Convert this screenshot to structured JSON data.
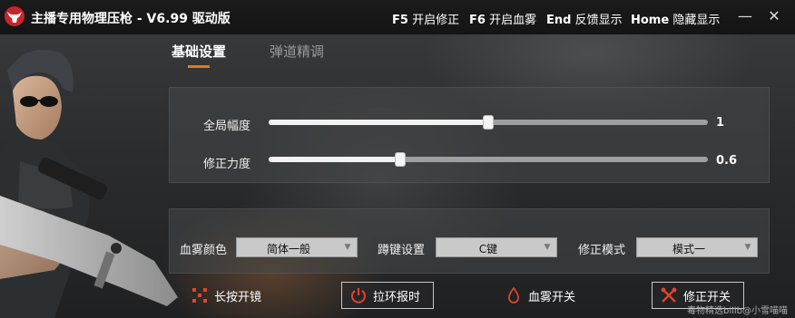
{
  "window": {
    "title": "主播专用物理压枪  - V6.99 驱动版",
    "hotkeys": [
      {
        "key": "F5",
        "label": "开启修正"
      },
      {
        "key": "F6",
        "label": "开启血雾"
      },
      {
        "key": "End",
        "label": "反馈显示"
      },
      {
        "key": "Home",
        "label": "隐藏显示"
      }
    ],
    "minimize": "—",
    "close": "✕"
  },
  "tabs": [
    {
      "label": "基础设置",
      "active": true
    },
    {
      "label": "弹道精调",
      "active": false
    }
  ],
  "sliders": [
    {
      "label": "全局幅度",
      "value": "1",
      "fraction": 0.5
    },
    {
      "label": "修正力度",
      "value": "0.6",
      "fraction": 0.3
    }
  ],
  "selects": [
    {
      "label": "血雾颜色",
      "value": "简体一般"
    },
    {
      "label": "蹲键设置",
      "value": "C键"
    },
    {
      "label": "修正模式",
      "value": "模式一"
    }
  ],
  "buttons": [
    {
      "label": "长按开镜",
      "icon": "crosshair-icon"
    },
    {
      "label": "拉环报时",
      "icon": "power-icon"
    },
    {
      "label": "血雾开关",
      "icon": "blood-drop-icon"
    },
    {
      "label": "修正开关",
      "icon": "wrench-cross-icon"
    }
  ],
  "watermark": "毒物精选bilib@小雪喵喵",
  "colors": {
    "accent": "#e07a1c",
    "logo": "#c8262a",
    "titlebar": "#151516"
  }
}
